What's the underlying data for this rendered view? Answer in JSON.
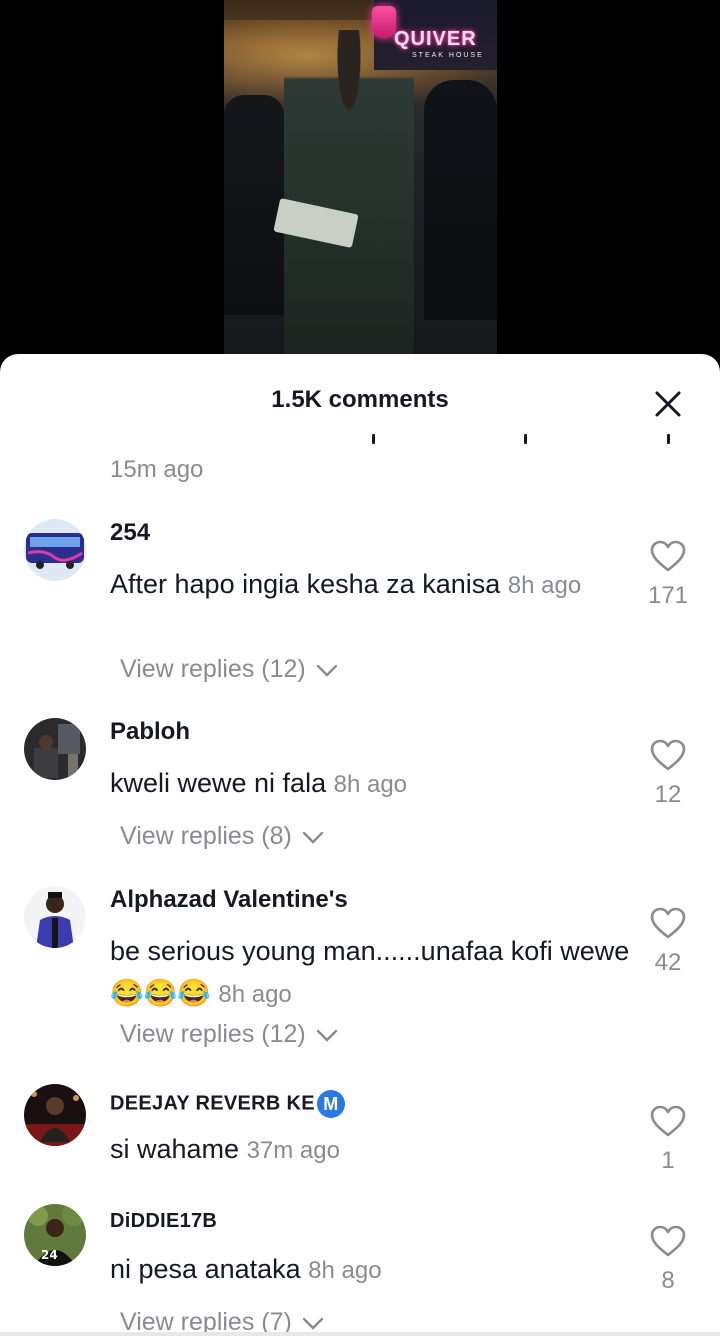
{
  "video": {
    "sign_text": "QUIVER",
    "sign_sub": "STEAK HOUSE"
  },
  "sheet": {
    "title": "1.5K comments",
    "prev_comment_time": "15m ago"
  },
  "comments": [
    {
      "username": "254",
      "text": "After hapo ingia kesha za kanisa",
      "time": "8h ago",
      "likes": "171",
      "replies": "View replies (12)"
    },
    {
      "username": "Pabloh",
      "text": "kweli wewe ni fala",
      "time": "8h ago",
      "likes": "12",
      "replies": "View replies (8)"
    },
    {
      "username": "Alphazad Valentine's",
      "text": "be serious young man......unafaa kofi wewe😂😂😂",
      "time": "8h ago",
      "likes": "42",
      "replies": "View replies (12)"
    },
    {
      "username": "DEEJAY REVERB KE",
      "badge": "M",
      "text": "si wahame",
      "time": "37m ago",
      "likes": "1"
    },
    {
      "username": "DiDDIE17B",
      "text": "ni pesa anataka",
      "time": "8h ago",
      "likes": "8",
      "replies": "View replies (7)"
    }
  ],
  "colors": {
    "text_primary": "#161823",
    "text_secondary": "#8a8b91",
    "badge_blue": "#2a78e4"
  },
  "icons": [
    "close-icon",
    "heart-outline-icon",
    "chevron-down-icon"
  ]
}
